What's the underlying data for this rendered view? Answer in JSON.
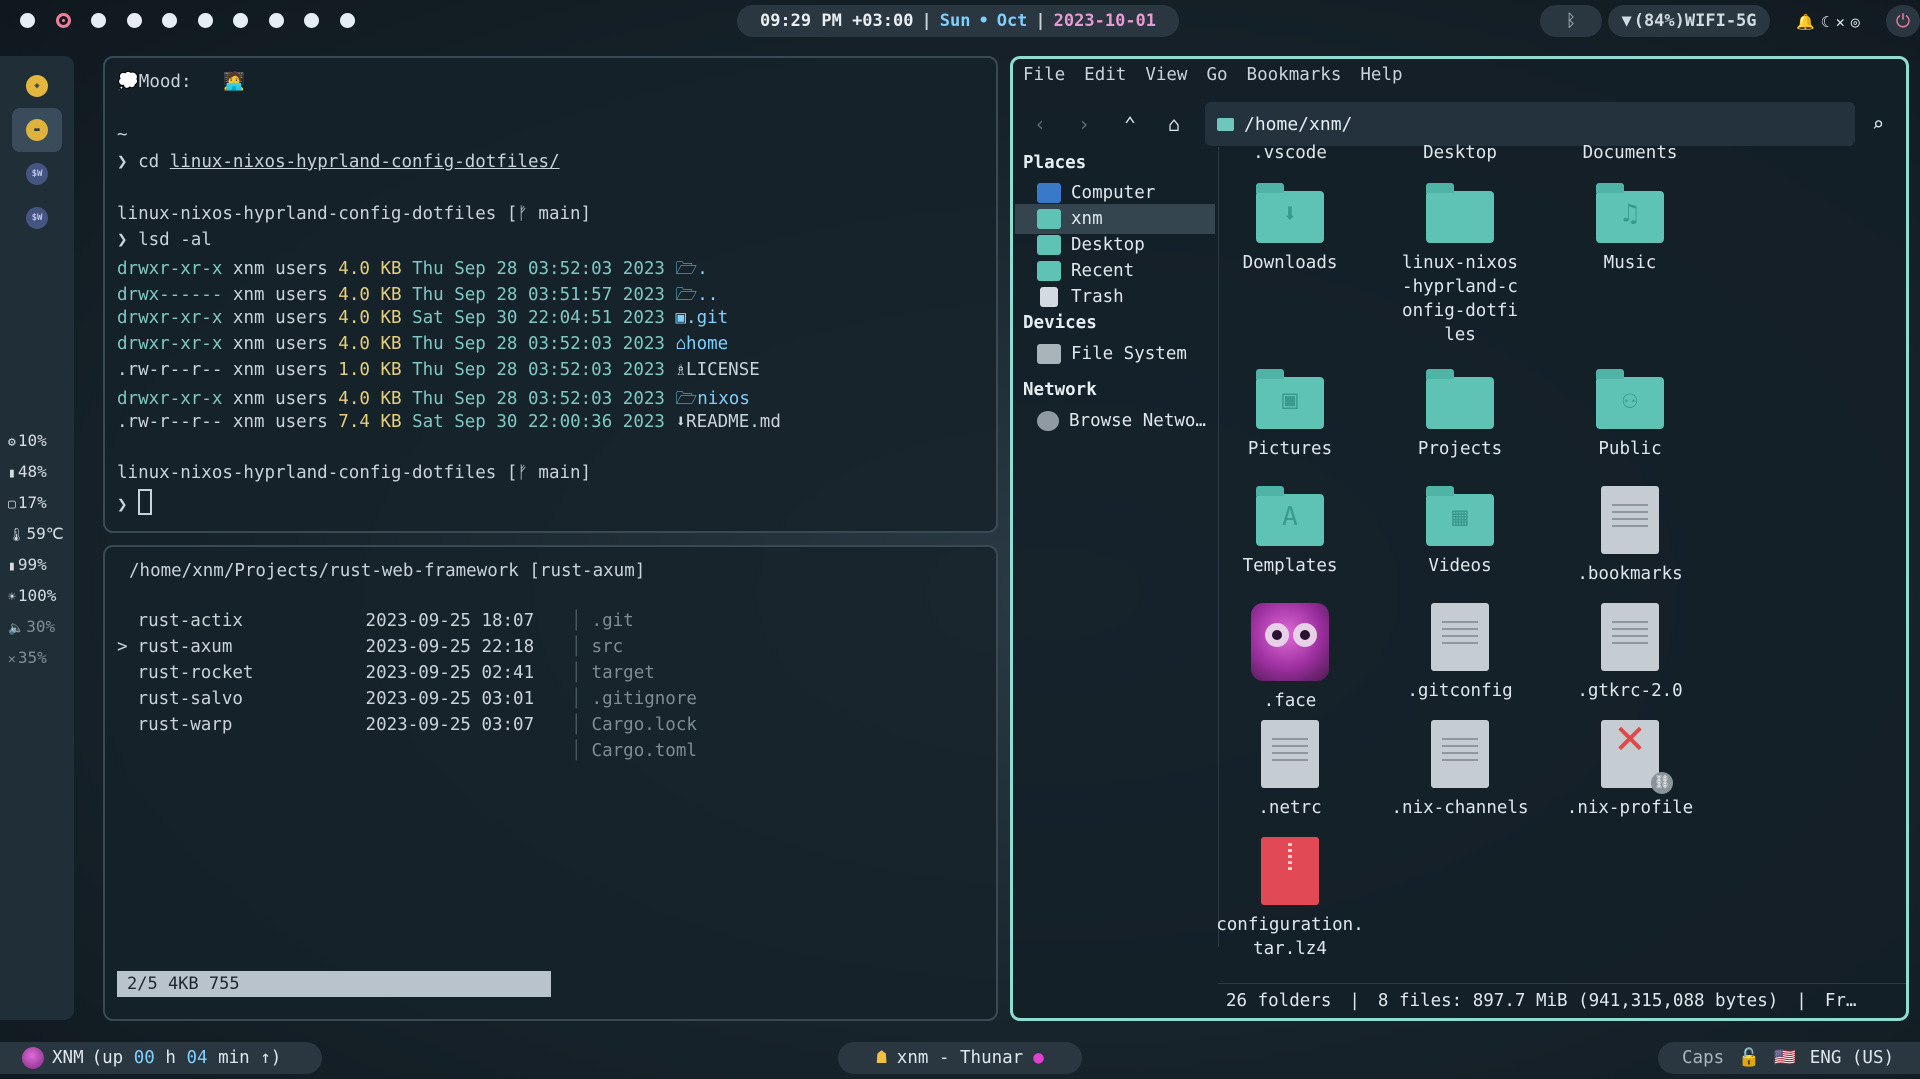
{
  "topbar": {
    "workspaces": 10,
    "active_workspace": 2,
    "time": "09:29 PM +03:00",
    "day": "Sun",
    "dot": "•",
    "month": "Oct",
    "date": "2023-10-01",
    "sep": "|",
    "bluetooth_icon": "bluetooth-icon",
    "wifi": "(84%)WIFI-5G",
    "power_icon": "power-icon"
  },
  "dock": {
    "stats": [
      {
        "icon": "cpu-icon",
        "glyph": "⚙",
        "value": "10%"
      },
      {
        "icon": "memory-icon",
        "glyph": "▮",
        "value": "48%"
      },
      {
        "icon": "disk-icon",
        "glyph": "▢",
        "value": "17%"
      },
      {
        "icon": "temperature-icon",
        "glyph": "🌡",
        "value": "59℃"
      },
      {
        "icon": "battery-icon",
        "glyph": "▮",
        "value": "99%"
      },
      {
        "icon": "brightness-icon",
        "glyph": "☀",
        "value": "100%"
      },
      {
        "icon": "volume-icon",
        "glyph": "🔈",
        "value": "30%"
      },
      {
        "icon": "mic-icon",
        "glyph": "✕",
        "value": "35%"
      }
    ]
  },
  "term1": {
    "mood_label": "Mood:",
    "tilde": "~",
    "prompt": "❯",
    "cmd1": "cd",
    "cmd1_arg": "linux-nixos-hyprland-config-dotfiles/",
    "dir": "linux-nixos-hyprland-config-dotfiles",
    "branch": "[ᚠ main]",
    "cmd2": "lsd -al",
    "rows": [
      {
        "perm": "drwxr-xr-x",
        "user": "xnm",
        "group": "users",
        "size": "4.0 KB",
        "date": "Thu Sep 28 03:52:03 2023",
        "icon": "🗁",
        "name": "."
      },
      {
        "perm": "drwx------",
        "user": "xnm",
        "group": "users",
        "size": "4.0 KB",
        "date": "Thu Sep 28 03:51:57 2023",
        "icon": "🗁",
        "name": ".."
      },
      {
        "perm": "drwxr-xr-x",
        "user": "xnm",
        "group": "users",
        "size": "4.0 KB",
        "date": "Sat Sep 30 22:04:51 2023",
        "icon": "▣",
        "name": ".git"
      },
      {
        "perm": "drwxr-xr-x",
        "user": "xnm",
        "group": "users",
        "size": "4.0 KB",
        "date": "Thu Sep 28 03:52:03 2023",
        "icon": "⌂",
        "name": "home"
      },
      {
        "perm": ".rw-r--r--",
        "user": "xnm",
        "group": "users",
        "size": "1.0 KB",
        "date": "Thu Sep 28 03:52:03 2023",
        "icon": "♗",
        "name": "LICENSE"
      },
      {
        "perm": "drwxr-xr-x",
        "user": "xnm",
        "group": "users",
        "size": "4.0 KB",
        "date": "Thu Sep 28 03:52:03 2023",
        "icon": "🗁",
        "name": "nixos"
      },
      {
        "perm": ".rw-r--r--",
        "user": "xnm",
        "group": "users",
        "size": "7.4 KB",
        "date": "Sat Sep 30 22:00:36 2023",
        "icon": "⬇",
        "name": "README.md"
      }
    ]
  },
  "term2": {
    "path": "/home/xnm/Projects/rust-web-framework",
    "branch": "[rust-axum]",
    "items": [
      {
        "marker": " ",
        "name": "rust-actix",
        "date": "2023-09-25 18:07"
      },
      {
        "marker": ">",
        "name": "rust-axum",
        "date": "2023-09-25 22:18"
      },
      {
        "marker": " ",
        "name": "rust-rocket",
        "date": "2023-09-25 02:41"
      },
      {
        "marker": " ",
        "name": "rust-salvo",
        "date": "2023-09-25 03:01"
      },
      {
        "marker": " ",
        "name": "rust-warp",
        "date": "2023-09-25 03:07"
      }
    ],
    "preview": [
      ".git",
      "src",
      "target",
      ".gitignore",
      "Cargo.lock",
      "Cargo.toml"
    ],
    "status": "2/5 4KB 755"
  },
  "thunar": {
    "menu": [
      "File",
      "Edit",
      "View",
      "Go",
      "Bookmarks",
      "Help"
    ],
    "path": "/home/xnm/",
    "sidebar": {
      "places_title": "Places",
      "places": [
        "Computer",
        "xnm",
        "Desktop",
        "Recent",
        "Trash"
      ],
      "devices_title": "Devices",
      "devices": [
        "File System"
      ],
      "network_title": "Network",
      "network": [
        "Browse Netwo…"
      ]
    },
    "top_row_labels": [
      ".vscode",
      "Desktop",
      "Documents"
    ],
    "files": [
      {
        "name": "Downloads",
        "kind": "folder",
        "emblem": "⬇"
      },
      {
        "name": "linux-nixos-hyprland-config-dotfiles",
        "kind": "folder",
        "emblem": ""
      },
      {
        "name": "Music",
        "kind": "folder",
        "emblem": "♫"
      },
      {
        "name": "Pictures",
        "kind": "folder",
        "emblem": "▣"
      },
      {
        "name": "Projects",
        "kind": "folder",
        "emblem": ""
      },
      {
        "name": "Public",
        "kind": "folder",
        "emblem": "⚇"
      },
      {
        "name": "Templates",
        "kind": "folder",
        "emblem": "A"
      },
      {
        "name": "Videos",
        "kind": "folder",
        "emblem": "▦"
      },
      {
        "name": ".bookmarks",
        "kind": "doc",
        "emblem": ""
      },
      {
        "name": ".face",
        "kind": "face",
        "emblem": ""
      },
      {
        "name": ".gitconfig",
        "kind": "doc",
        "emblem": ""
      },
      {
        "name": ".gtkrc-2.0",
        "kind": "doc",
        "emblem": ""
      },
      {
        "name": ".netrc",
        "kind": "doc",
        "emblem": ""
      },
      {
        "name": ".nix-channels",
        "kind": "doc",
        "emblem": ""
      },
      {
        "name": ".nix-profile",
        "kind": "broken-link",
        "emblem": "✕"
      },
      {
        "name": "configuration.tar.lz4",
        "kind": "archive",
        "emblem": ""
      }
    ],
    "status": {
      "folders": "26 folders",
      "sep": "|",
      "files": "8 files: 897.7 MiB (941,315,088 bytes)",
      "free": "Fr…"
    }
  },
  "bottombar": {
    "user": "XNM",
    "up_prefix": "(up",
    "hours": "00",
    "h": "h",
    "mins": "04",
    "min_suffix": "min ↑)",
    "window_title": "xnm - Thunar",
    "caps": "Caps",
    "lang": "ENG (US)"
  }
}
